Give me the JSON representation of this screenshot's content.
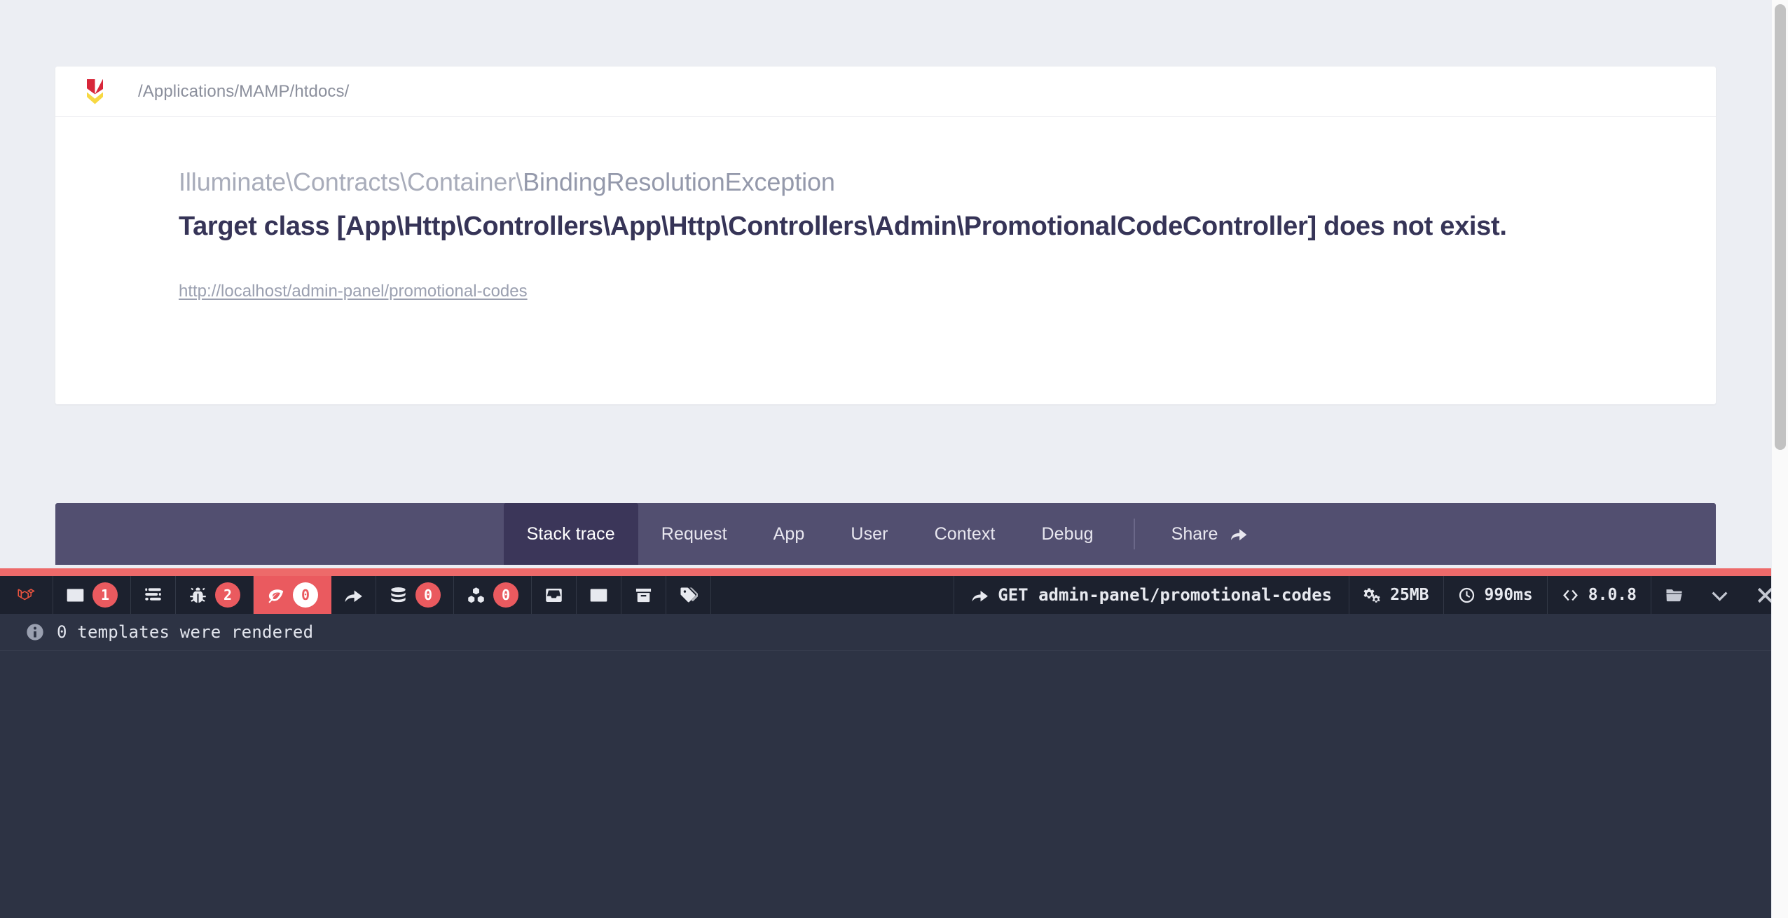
{
  "error_page": {
    "path": "/Applications/MAMP/htdocs/",
    "logo_name": "flare-logo",
    "exception_class_prefix": "Illuminate\\Contracts\\Container\\",
    "exception_class_name": "BindingResolutionException",
    "exception_message": "Target class [App\\Http\\Controllers\\App\\Http\\Controllers\\Admin\\PromotionalCodeController] does not exist.",
    "request_url": "http://localhost/admin-panel/promotional-codes"
  },
  "tabbar": {
    "tabs": [
      {
        "label": "Stack trace",
        "active": true
      },
      {
        "label": "Request",
        "active": false
      },
      {
        "label": "App",
        "active": false
      },
      {
        "label": "User",
        "active": false
      },
      {
        "label": "Context",
        "active": false
      },
      {
        "label": "Debug",
        "active": false
      }
    ],
    "share_label": "Share",
    "share_icon": "share-arrow-icon"
  },
  "debugbar": {
    "logo": "laravel-logo",
    "items": [
      {
        "name": "messages",
        "icon": "messages-icon",
        "badge": "1",
        "active": false
      },
      {
        "name": "timeline",
        "icon": "timeline-icon",
        "badge": "",
        "active": false
      },
      {
        "name": "exceptions",
        "icon": "bug-icon",
        "badge": "2",
        "active": false
      },
      {
        "name": "views",
        "icon": "leaf-icon",
        "badge": "0",
        "active": true
      },
      {
        "name": "route",
        "icon": "route-arrow-icon",
        "badge": "",
        "active": false
      },
      {
        "name": "queries",
        "icon": "database-icon",
        "badge": "0",
        "active": false
      },
      {
        "name": "models",
        "icon": "cubes-icon",
        "badge": "0",
        "active": false
      },
      {
        "name": "mails",
        "icon": "inbox-icon",
        "badge": "",
        "active": false
      },
      {
        "name": "session",
        "icon": "list-icon",
        "badge": "",
        "active": false
      },
      {
        "name": "cache",
        "icon": "archive-icon",
        "badge": "",
        "active": false
      },
      {
        "name": "gate",
        "icon": "tags-icon",
        "badge": "",
        "active": false
      }
    ],
    "stats": [
      {
        "name": "route",
        "icon": "route-arrow-icon",
        "value": "GET admin-panel/promotional-codes"
      },
      {
        "name": "memory",
        "icon": "gears-icon",
        "value": "25MB"
      },
      {
        "name": "time",
        "icon": "clock-icon",
        "value": "990ms"
      },
      {
        "name": "php-version",
        "icon": "code-icon",
        "value": "8.0.8"
      }
    ],
    "controls": [
      {
        "name": "open-folder",
        "icon": "folder-icon"
      },
      {
        "name": "minimize",
        "icon": "chevron-down-icon"
      },
      {
        "name": "close",
        "icon": "close-icon"
      }
    ],
    "status_text": "0 templates were rendered",
    "status_icon": "info-icon"
  },
  "colors": {
    "page_bg": "#eceef3",
    "card_bg": "#ffffff",
    "tabbar_bg": "#524f70",
    "tab_active_bg": "#3b3659",
    "debugbar_bg": "#1c212e",
    "debugbar_panel_bg": "#2d3344",
    "accent_red": "#ea5a5f",
    "handle_red": "#ed6a6a",
    "heading_text": "#363457"
  }
}
